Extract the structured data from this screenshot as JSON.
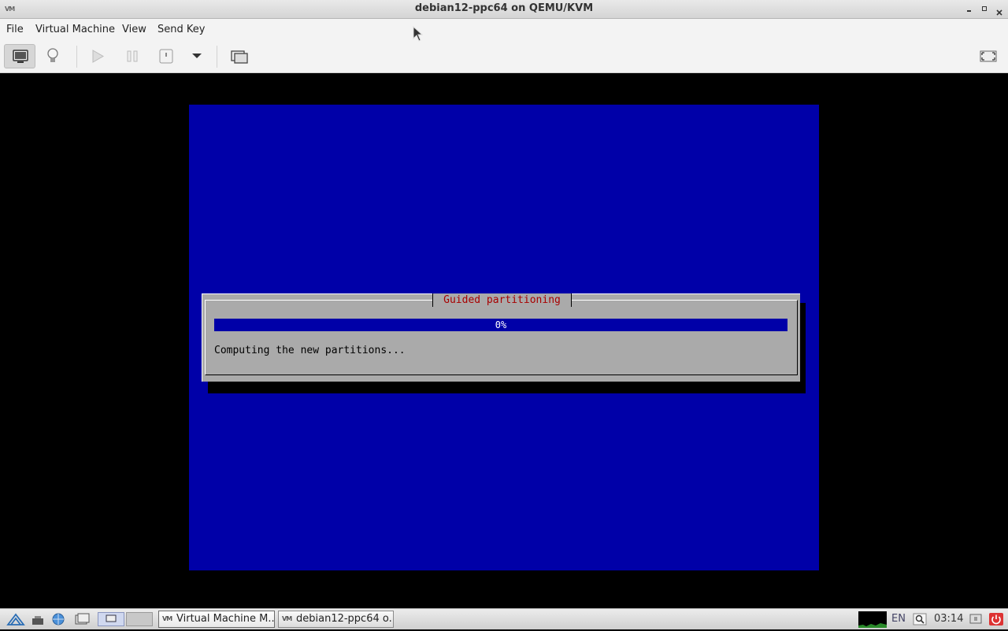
{
  "window": {
    "title": "debian12-ppc64 on QEMU/KVM",
    "app_icon_text": "VM"
  },
  "menu": {
    "items": [
      "File",
      "Virtual Machine",
      "View",
      "Send Key"
    ]
  },
  "toolbar": {
    "buttons": [
      "console-view",
      "details-view",
      "run",
      "pause",
      "shutdown",
      "shutdown-menu",
      "snapshots",
      "fullscreen"
    ]
  },
  "installer": {
    "dialog_title": "Guided partitioning",
    "progress_percent": 0,
    "progress_label": "0%",
    "status": "Computing the new partitions...",
    "colors": {
      "screen_bg": "#0000a8",
      "dialog_bg": "#aaaaaa",
      "title_fg": "#a80000"
    }
  },
  "taskbar": {
    "tasks": [
      {
        "label": "Virtual Machine M...",
        "active": true
      },
      {
        "label": "debian12-ppc64 o...",
        "active": false
      }
    ],
    "keyboard_layout": "EN",
    "clock": "03:14"
  }
}
